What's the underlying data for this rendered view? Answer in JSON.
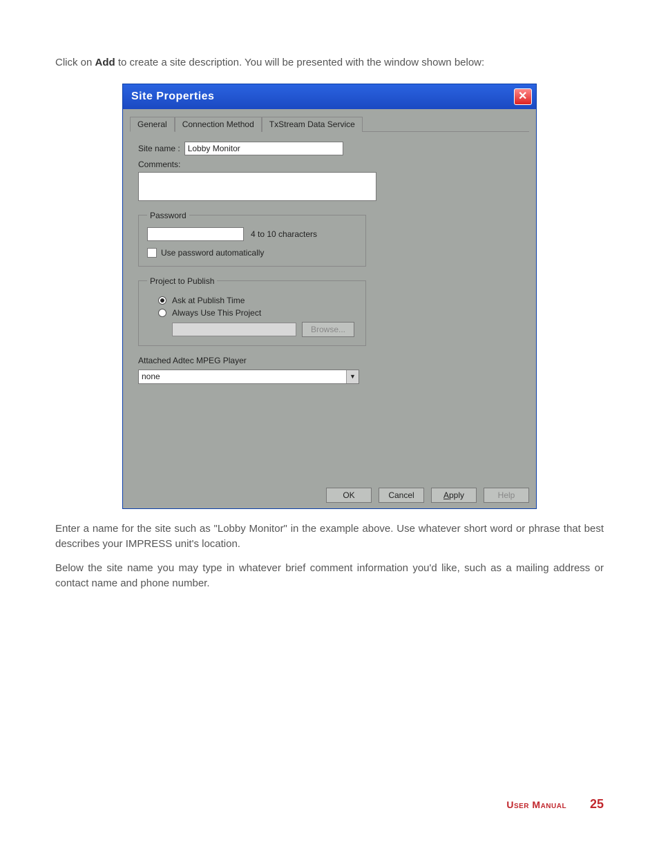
{
  "intro": {
    "pre": "Click on ",
    "bold": "Add",
    "post": " to create a site description. You will be presented with the window shown below:"
  },
  "dialog": {
    "title": "Site Properties",
    "tabs": [
      "General",
      "Connection Method",
      "TxStream Data Service"
    ],
    "site_name_label": "Site name :",
    "site_name_value": "Lobby Monitor",
    "comments_label": "Comments:",
    "password_legend": "Password",
    "password_hint": "4 to 10 characters",
    "password_auto_label": "Use password automatically",
    "project_legend": "Project to Publish",
    "radio_ask": "Ask at Publish Time",
    "radio_always": "Always Use This Project",
    "browse_label": "Browse...",
    "attached_label": "Attached Adtec MPEG Player",
    "dropdown_value": "none",
    "buttons": {
      "ok": "OK",
      "cancel": "Cancel",
      "apply": "Apply",
      "help": "Help"
    }
  },
  "para1": "Enter a name for the site such as \"Lobby Monitor\" in the example above. Use whatever short word or phrase that best describes your IMPRESS unit's location.",
  "para2": "Below the site name you may type in whatever brief comment information you'd like, such as a mailing address or contact name and phone number.",
  "footer": {
    "label": "User Manual",
    "page": "25"
  }
}
